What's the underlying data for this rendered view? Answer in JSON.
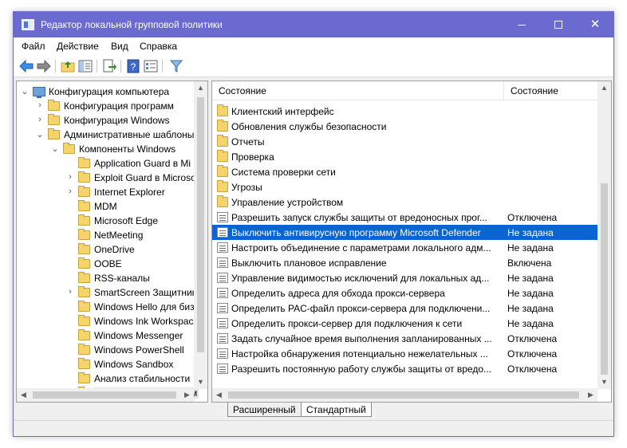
{
  "window": {
    "title": "Редактор локальной групповой политики",
    "accent": "#6a6ad0"
  },
  "menu": [
    "Файл",
    "Действие",
    "Вид",
    "Справка"
  ],
  "toolbar_icons": [
    "back-arrow-icon",
    "forward-arrow-icon",
    "up-folder-icon",
    "show-hide-tree-icon",
    "export-list-icon",
    "help-icon",
    "properties-icon",
    "filter-icon"
  ],
  "tree": [
    {
      "label": "Конфигурация компьютера",
      "chevron": "⌄"
    },
    {
      "label": "Конфигурация программ",
      "chevron": "›"
    },
    {
      "label": "Конфигурация Windows",
      "chevron": "›"
    },
    {
      "label": "Административные шаблоны",
      "chevron": "⌄"
    },
    {
      "label": "Компоненты Windows",
      "chevron": "⌄"
    },
    {
      "label": "Application Guard в Mi",
      "chevron": ""
    },
    {
      "label": "Exploit Guard в Microso",
      "chevron": "›"
    },
    {
      "label": "Internet Explorer",
      "chevron": "›"
    },
    {
      "label": "MDM",
      "chevron": ""
    },
    {
      "label": "Microsoft Edge",
      "chevron": ""
    },
    {
      "label": "NetMeeting",
      "chevron": ""
    },
    {
      "label": "OneDrive",
      "chevron": ""
    },
    {
      "label": "OOBE",
      "chevron": ""
    },
    {
      "label": "RSS-каналы",
      "chevron": ""
    },
    {
      "label": "SmartScreen Защитник",
      "chevron": "›"
    },
    {
      "label": "Windows Hello для биз",
      "chevron": ""
    },
    {
      "label": "Windows Ink Workspac",
      "chevron": ""
    },
    {
      "label": "Windows Messenger",
      "chevron": ""
    },
    {
      "label": "Windows PowerShell",
      "chevron": ""
    },
    {
      "label": "Windows Sandbox",
      "chevron": ""
    },
    {
      "label": "Анализ стабильности",
      "chevron": ""
    },
    {
      "label": "Антивирусная програм",
      "chevron": "›"
    }
  ],
  "list": {
    "headers": {
      "name": "Состояние",
      "state": "Состояние"
    },
    "rows": [
      {
        "type": "folder",
        "name": "Клиентский интерфейс",
        "state": ""
      },
      {
        "type": "folder",
        "name": "Обновления службы безопасности",
        "state": ""
      },
      {
        "type": "folder",
        "name": "Отчеты",
        "state": ""
      },
      {
        "type": "folder",
        "name": "Проверка",
        "state": ""
      },
      {
        "type": "folder",
        "name": "Система проверки сети",
        "state": ""
      },
      {
        "type": "folder",
        "name": "Угрозы",
        "state": ""
      },
      {
        "type": "folder",
        "name": "Управление устройством",
        "state": ""
      },
      {
        "type": "policy",
        "name": "Разрешить запуск службы защиты от вредоносных прог...",
        "state": "Отключена"
      },
      {
        "type": "policy",
        "name": "Выключить антивирусную программу Microsoft Defender",
        "state": "Не задана"
      },
      {
        "type": "policy",
        "name": "Настроить объединение с параметрами локального адм...",
        "state": "Не задана"
      },
      {
        "type": "policy",
        "name": "Выключить плановое исправление",
        "state": "Включена"
      },
      {
        "type": "policy",
        "name": "Управление видимостью исключений для локальных ад...",
        "state": "Не задана"
      },
      {
        "type": "policy",
        "name": "Определить адреса для обхода прокси-сервера",
        "state": "Не задана"
      },
      {
        "type": "policy",
        "name": "Определить PAC-файл прокси-сервера для подключени...",
        "state": "Не задана"
      },
      {
        "type": "policy",
        "name": "Определить прокси-сервер для подключения к сети",
        "state": "Не задана"
      },
      {
        "type": "policy",
        "name": "Задать случайное время выполнения запланированных ...",
        "state": "Отключена"
      },
      {
        "type": "policy",
        "name": "Настройка обнаружения потенциально нежелательных ...",
        "state": "Отключена"
      },
      {
        "type": "policy",
        "name": "Разрешить постоянную работу службы защиты от вредо...",
        "state": "Отключена"
      }
    ]
  },
  "tabs": [
    "Расширенный",
    "Стандартный"
  ],
  "selection_color": "#0a64d2"
}
